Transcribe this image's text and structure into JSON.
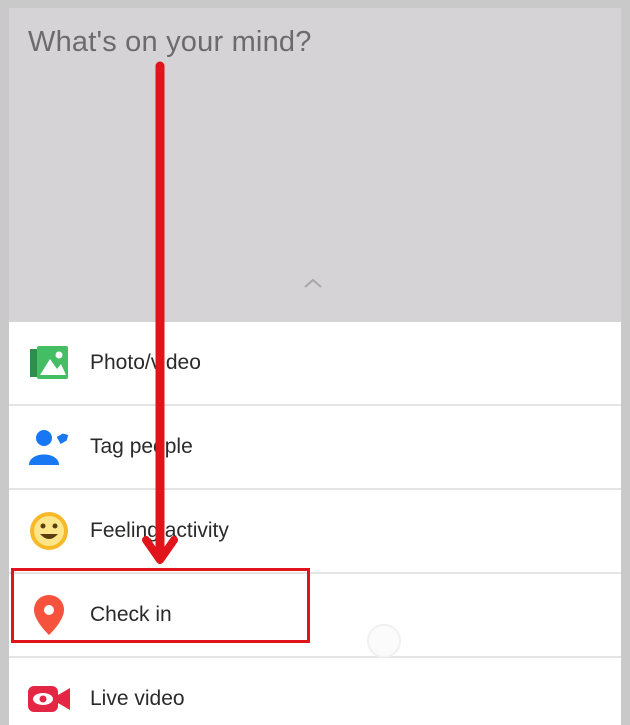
{
  "composer": {
    "placeholder": "What's on your mind?",
    "collapse_icon": "chevron-up-icon"
  },
  "options": [
    {
      "label": "Photo/video",
      "icon": "photo-icon"
    },
    {
      "label": "Tag people",
      "icon": "tag-people-icon"
    },
    {
      "label": "Feeling/activity",
      "icon": "feeling-icon"
    },
    {
      "label": "Check in",
      "icon": "location-pin-icon"
    },
    {
      "label": "Live video",
      "icon": "live-video-icon"
    }
  ],
  "colors": {
    "annotation_red": "#e0141a",
    "photo_green": "#45bd62",
    "tag_blue": "#1877f2",
    "feeling_yellow": "#f7b928",
    "checkin_orange": "#f5533d",
    "live_red": "#e42645"
  }
}
